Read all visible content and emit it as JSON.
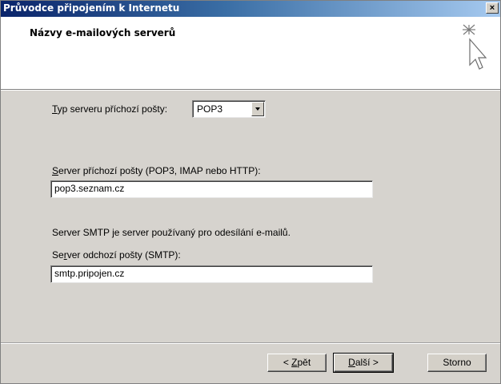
{
  "window": {
    "title": "Průvodce připojením k Internetu",
    "close_label": "×"
  },
  "header": {
    "title": "Názvy e-mailových serverů",
    "icon": "wizard-cursor-icon"
  },
  "incoming_type": {
    "label_mnemonic": "T",
    "label_rest": "yp serveru příchozí pošty:",
    "value": "POP3"
  },
  "incoming_server": {
    "label_mnemonic": "S",
    "label_rest": "erver příchozí pošty (POP3, IMAP nebo HTTP):",
    "value": "pop3.seznam.cz"
  },
  "smtp_note": "Server SMTP je server používaný pro odesílání e-mailů.",
  "outgoing_server": {
    "label_pre": "Se",
    "label_mnemonic": "r",
    "label_rest": "ver odchozí pošty (SMTP):",
    "value": "smtp.pripojen.cz"
  },
  "buttons": {
    "back_pre": "< ",
    "back_mnemonic": "Z",
    "back_rest": "pět",
    "next_mnemonic": "D",
    "next_rest": "alší >",
    "cancel": "Storno"
  }
}
